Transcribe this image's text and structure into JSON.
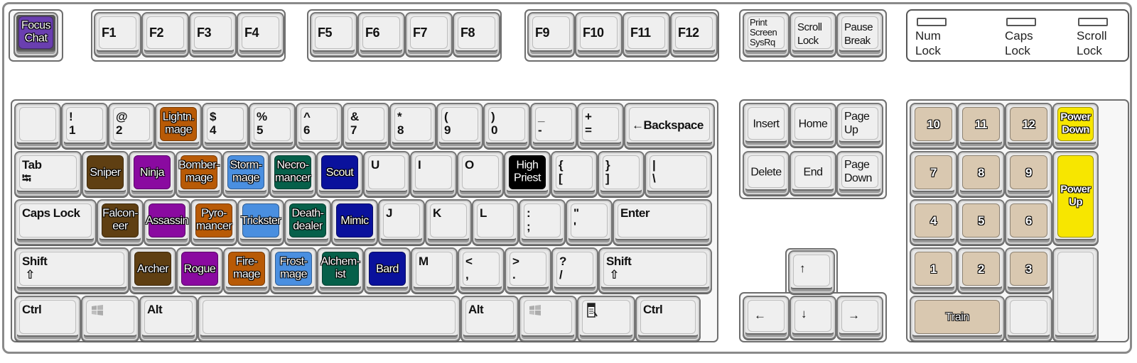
{
  "colors": {
    "key_default": "#efefef",
    "focus_chat": "#6a3fb0",
    "brown": "#5f3f12",
    "purple": "#8a0aa0",
    "orange": "#b85a06",
    "light_blue": "#4a8fe0",
    "teal": "#06604a",
    "navy": "#0a119c",
    "black": "#000000",
    "tan": "#d9c8b0",
    "yellow": "#f7e600"
  },
  "top_row": {
    "focus_chat": "Focus\nChat",
    "f_keys": [
      "F1",
      "F2",
      "F3",
      "F4",
      "F5",
      "F6",
      "F7",
      "F8",
      "F9",
      "F10",
      "F11",
      "F12"
    ],
    "print_screen": "Print\nScreen\nSysRq",
    "scroll_lock": "Scroll\nLock",
    "pause_break": "Pause\nBreak"
  },
  "leds": [
    {
      "label": "Num\nLock"
    },
    {
      "label": "Caps\nLock"
    },
    {
      "label": "Scroll\nLock"
    }
  ],
  "number_row": [
    {
      "label": ""
    },
    {
      "label": "!\n1"
    },
    {
      "label": "@\n2"
    },
    {
      "label": "Lightn.\nmage",
      "color": "orange"
    },
    {
      "label": "$\n4"
    },
    {
      "label": "%\n5"
    },
    {
      "label": "^\n6"
    },
    {
      "label": "&\n7"
    },
    {
      "label": "*\n8"
    },
    {
      "label": "(\n9"
    },
    {
      "label": ")\n0"
    },
    {
      "label": "_\n-"
    },
    {
      "label": "+\n="
    },
    {
      "label": "←Backspace"
    }
  ],
  "tab_row": [
    {
      "label": "Tab\n⭾"
    },
    {
      "label": "Sniper",
      "color": "brown"
    },
    {
      "label": "Ninja",
      "color": "purple"
    },
    {
      "label": "Bomber-\nmage",
      "color": "orange"
    },
    {
      "label": "Storm-\nmage",
      "color": "light_blue"
    },
    {
      "label": "Necro-\nmancer",
      "color": "teal"
    },
    {
      "label": "Scout",
      "color": "navy"
    },
    {
      "label": "U"
    },
    {
      "label": "I"
    },
    {
      "label": "O"
    },
    {
      "label": "High\nPriest",
      "color": "black"
    },
    {
      "label": "{\n["
    },
    {
      "label": "}\n]"
    },
    {
      "label": "|\n\\"
    }
  ],
  "caps_row": [
    {
      "label": "Caps Lock"
    },
    {
      "label": "Falcon-\neer",
      "color": "brown"
    },
    {
      "label": "Assassin",
      "color": "purple"
    },
    {
      "label": "Pyro-\nmancer",
      "color": "orange"
    },
    {
      "label": "Trickster",
      "color": "light_blue"
    },
    {
      "label": "Death-\ndealer",
      "color": "teal"
    },
    {
      "label": "Mimic",
      "color": "navy"
    },
    {
      "label": "J"
    },
    {
      "label": "K"
    },
    {
      "label": "L"
    },
    {
      "label": ":\n;"
    },
    {
      "label": "\"\n'"
    },
    {
      "label": "Enter"
    }
  ],
  "shift_row": [
    {
      "label": "Shift\n ⇧"
    },
    {
      "label": "Archer",
      "color": "brown"
    },
    {
      "label": "Rogue",
      "color": "purple"
    },
    {
      "label": "Fire-\nmage",
      "color": "orange"
    },
    {
      "label": "Frost-\nmage",
      "color": "light_blue"
    },
    {
      "label": "Alchem-\nist",
      "color": "teal"
    },
    {
      "label": "Bard",
      "color": "navy"
    },
    {
      "label": "M"
    },
    {
      "label": "<\n,"
    },
    {
      "label": ">\n."
    },
    {
      "label": "?\n/"
    },
    {
      "label": "Shift\n ⇧"
    }
  ],
  "bottom_row": [
    {
      "label": "Ctrl"
    },
    {
      "label": "",
      "icon": "windows-logo-icon"
    },
    {
      "label": "Alt"
    },
    {
      "label": ""
    },
    {
      "label": "Alt"
    },
    {
      "label": "",
      "icon": "windows-logo-icon"
    },
    {
      "label": "",
      "icon": "context-menu-icon"
    },
    {
      "label": "Ctrl"
    }
  ],
  "nav_cluster": {
    "insert": "Insert",
    "home": "Home",
    "page_up": "Page\nUp",
    "delete": "Delete",
    "end": "End",
    "page_down": "Page\nDown"
  },
  "arrows": {
    "up": "↑",
    "left": "←",
    "down": "↓",
    "right": "→"
  },
  "numpad": {
    "row1": [
      "10",
      "11",
      "12"
    ],
    "power_down": "Power\nDown",
    "row2": [
      "7",
      "8",
      "9"
    ],
    "power_up": "Power\nUp",
    "row3": [
      "4",
      "5",
      "6"
    ],
    "row4": [
      "1",
      "2",
      "3"
    ],
    "train": "Train",
    "blank_small": "",
    "blank_tall": ""
  }
}
